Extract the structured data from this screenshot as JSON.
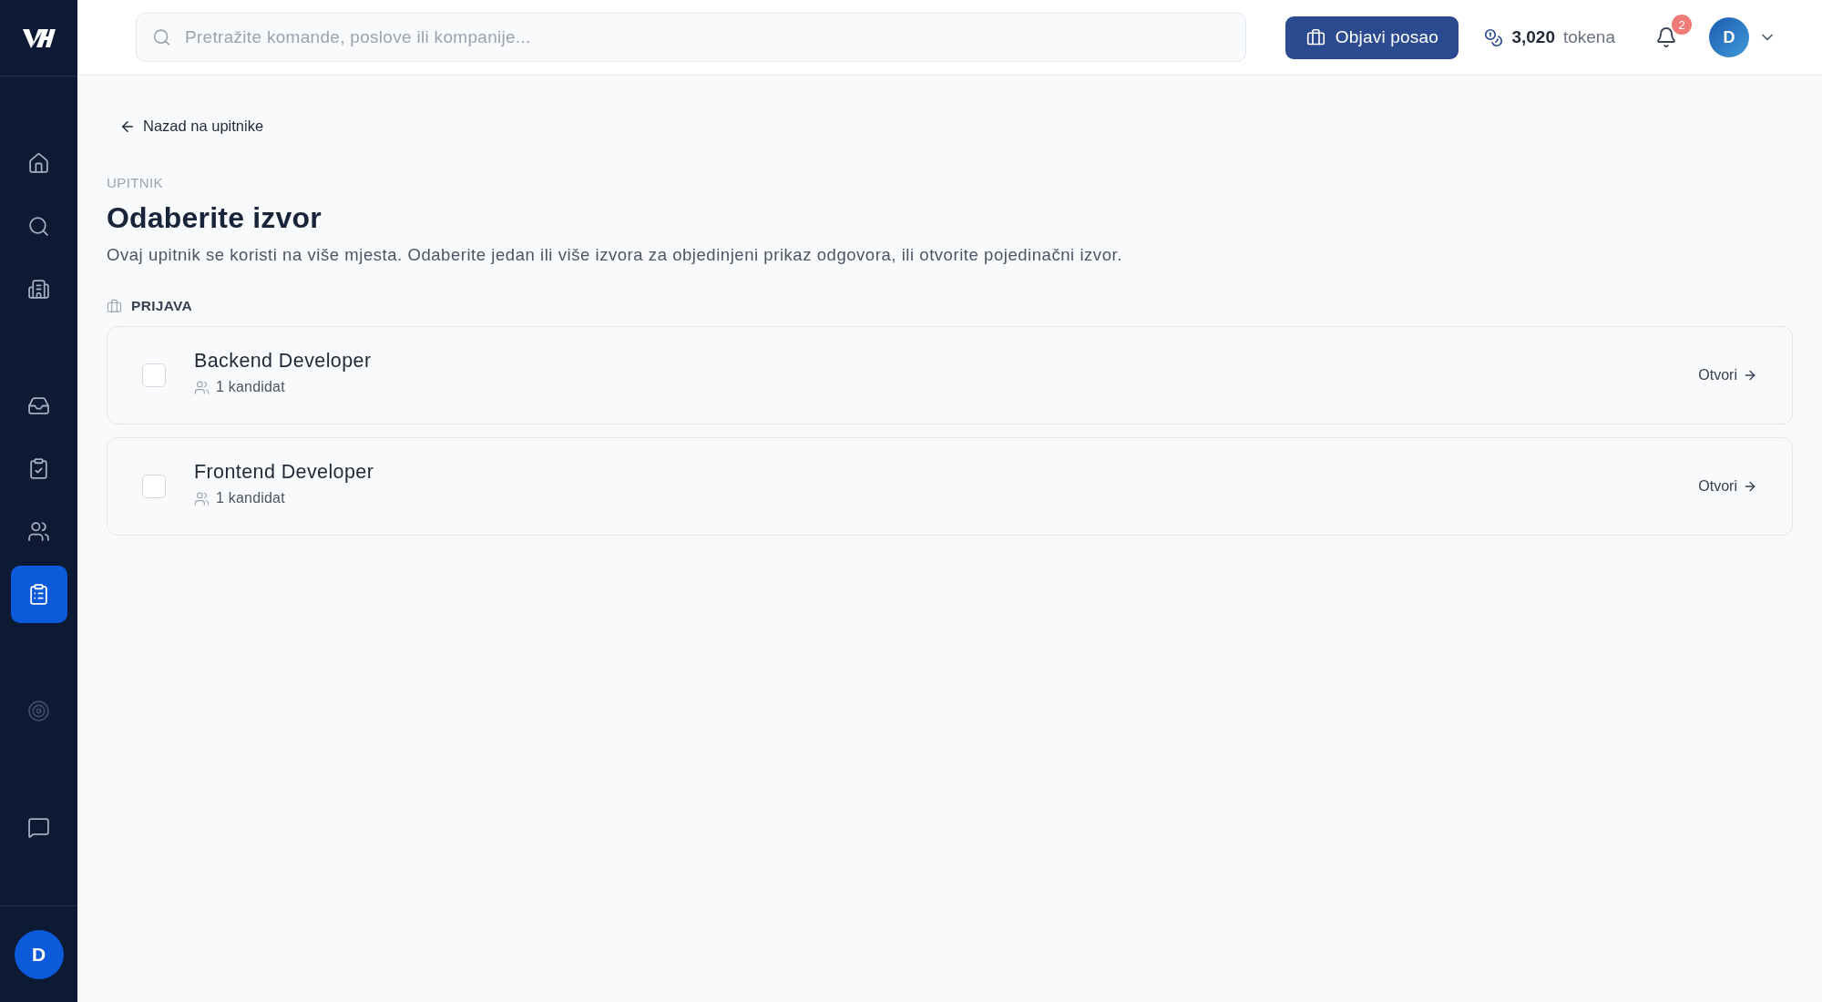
{
  "sidebar": {
    "groups": [
      {
        "items": [
          {
            "selected": false,
            "disabled": false
          },
          {
            "selected": false,
            "disabled": false
          },
          {
            "selected": false,
            "disabled": false
          }
        ]
      },
      {
        "items": [
          {
            "selected": false,
            "disabled": false
          },
          {
            "selected": false,
            "disabled": false
          },
          {
            "selected": false,
            "disabled": false
          },
          {
            "selected": true,
            "disabled": false
          }
        ]
      },
      {
        "items": [
          {
            "selected": false,
            "disabled": true
          }
        ]
      },
      {
        "items": [
          {
            "selected": false,
            "disabled": false
          }
        ]
      }
    ],
    "avatar": "D"
  },
  "topbar": {
    "search": {
      "placeholder": "Pretražite komande, poslove ili kompanije..."
    },
    "post_button": "Objavi posao",
    "tokens": {
      "amount": "3,020",
      "unit": "tokena"
    },
    "notifications": {
      "count": "2"
    },
    "avatar": "D"
  },
  "back_link": "Nazad na upitnike",
  "eyebrow": "UPITNIK",
  "title": "Odaberite izvor",
  "description": "Ovaj upitnik se koristi na više mjesta. Odaberite jedan ili više izvora za objedinjeni prikaz odgovora, ili otvorite pojedinačni izvor.",
  "section": {
    "label": "PRIJAVA",
    "sources": [
      {
        "name": "Backend Developer",
        "candidates": "1 kandidat",
        "checked": false,
        "action": "Otvori"
      },
      {
        "name": "Frontend Developer",
        "candidates": "1 kandidat",
        "checked": false,
        "action": "Otvori"
      }
    ]
  }
}
